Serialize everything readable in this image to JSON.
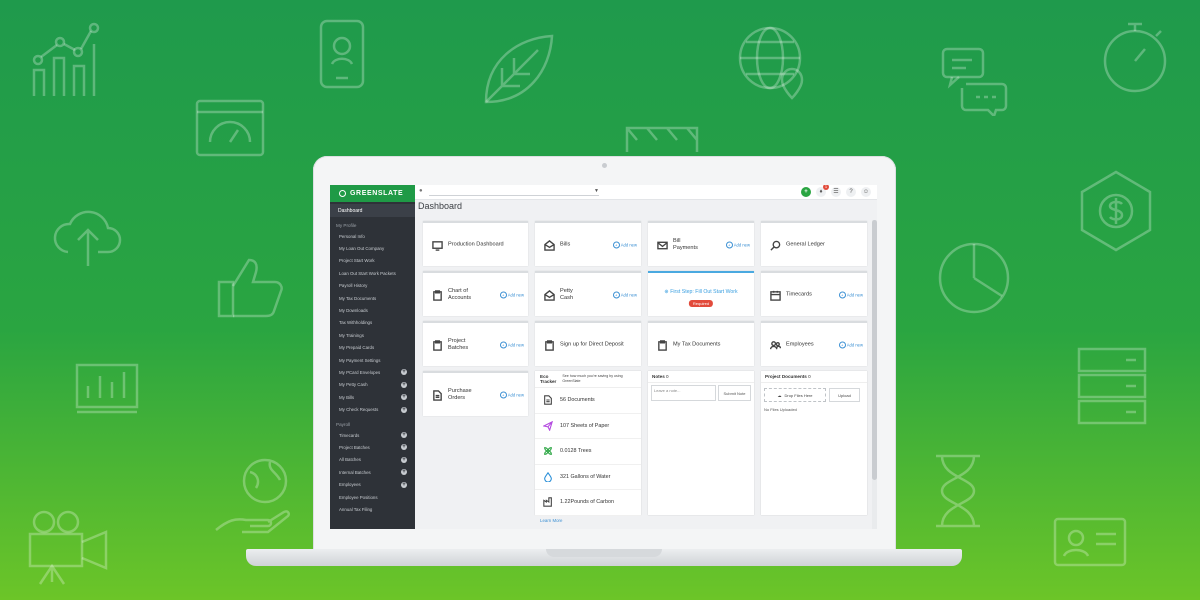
{
  "brand": {
    "name": "GREENSLATE",
    "primary": "#1f9a46",
    "accent": "#3a8fd3",
    "alert": "#e24b3b"
  },
  "topbar": {
    "icons": [
      "plus-icon",
      "bell-icon",
      "tasks-icon",
      "help-icon",
      "user-icon"
    ],
    "notification_count": "1"
  },
  "sidebar": {
    "dashboard": "Dashboard",
    "profile_title": "My Profile",
    "profile_items": [
      {
        "label": "Personal Info"
      },
      {
        "label": "My Loan Out Company"
      },
      {
        "label": "Project Start Work"
      },
      {
        "label": "Loan Out Start Work Packets"
      },
      {
        "label": "Payroll History"
      },
      {
        "label": "My Tax Documents"
      },
      {
        "label": "My Downloads"
      },
      {
        "label": "Tax Withholdings"
      },
      {
        "label": "My Trainings"
      },
      {
        "label": "My Prepaid Cards"
      },
      {
        "label": "My Payment Settings"
      },
      {
        "label": "My PCard Envelopes",
        "plus": "+"
      },
      {
        "label": "My Petty Cash",
        "plus": "+"
      },
      {
        "label": "My Bills",
        "plus": "+"
      },
      {
        "label": "My Check Requests",
        "plus": "+"
      }
    ],
    "payroll_title": "Payroll",
    "payroll_items": [
      {
        "label": "Timecards",
        "plus": "+"
      },
      {
        "label": "Project Batches",
        "plus": "+"
      },
      {
        "label": "All Batches",
        "plus": "+"
      },
      {
        "label": "Internal Batches",
        "plus": "+"
      },
      {
        "label": "Employees",
        "plus": "+"
      },
      {
        "label": "Employee Positions"
      },
      {
        "label": "Annual Tax Filing"
      }
    ]
  },
  "dashboard": {
    "title": "Dashboard",
    "add_new": "Add new",
    "cards": {
      "production_dashboard": "Production Dashboard",
      "bills": "Bills",
      "bill_payments": "Bill\nPayments",
      "general_ledger": "General Ledger",
      "chart_of_accounts": "Chart of\nAccounts",
      "petty_cash": "Petty\nCash",
      "first_step": "First Step: Fill Out Start Work",
      "required": "Required",
      "timecards": "Timecards",
      "project_batches": "Project\nBatches",
      "direct_deposit": "Sign up for Direct Deposit",
      "my_tax_documents": "My Tax Documents",
      "employees": "Employees",
      "purchase_orders": "Purchase\nOrders"
    },
    "eco": {
      "title": "Eco\nTracker",
      "description": "See how much you're saving by using GreenSlate",
      "rows": [
        {
          "value": "56 Documents",
          "icon": "document-icon"
        },
        {
          "value": "107 Sheets of Paper",
          "icon": "paper-plane-icon"
        },
        {
          "value": "0.0128 Trees",
          "icon": "tree-icon"
        },
        {
          "value": "321 Gallons of Water",
          "icon": "water-drop-icon"
        },
        {
          "value": "1.22Pounds of Carbon",
          "icon": "factory-icon"
        }
      ],
      "learn_more": "Learn More"
    },
    "notes": {
      "title": "Notes",
      "count": "0",
      "placeholder": "Leave a note...",
      "submit": "Submit Note"
    },
    "project_documents": {
      "title": "Project Documents",
      "count": "0",
      "drop": "Drop Files Here",
      "upload": "Upload",
      "empty": "No Files Uploaded"
    }
  }
}
